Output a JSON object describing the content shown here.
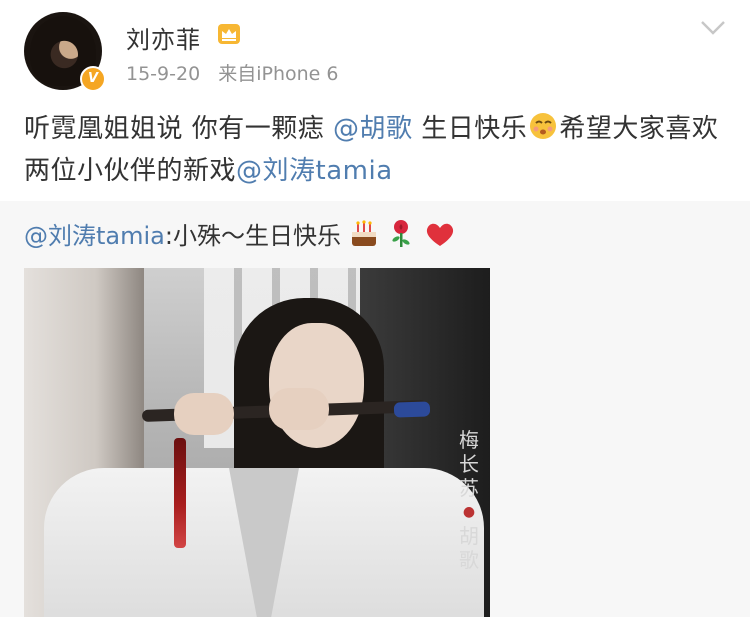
{
  "post": {
    "username": "刘亦菲",
    "verified_badge": "V",
    "timestamp": "15-9-20",
    "source": "来自iPhone 6",
    "text_part1": "听霓凰姐姐说 你有一颗痣 ",
    "mention1": "@胡歌",
    "text_part2": " 生日快乐",
    "text_part3": "希望大家喜欢两位小伙伴的新戏",
    "mention2": "@刘涛tamia"
  },
  "repost": {
    "mention": "@刘涛tamia",
    "text": ":小殊～生日快乐",
    "image": {
      "watermark_title": "梅长苏",
      "watermark_name": "胡歌"
    }
  },
  "icons": {
    "crown": "crown-icon",
    "chevron": "chevron-down-icon",
    "kiss_emoji": "kiss-emoji-icon",
    "cake_emoji": "cake-emoji-icon",
    "rose_emoji": "rose-emoji-icon",
    "heart_emoji": "heart-emoji-icon"
  },
  "colors": {
    "link": "#507daf",
    "meta": "#939393",
    "repost_bg": "#f7f7f7",
    "badge": "#f5a623"
  }
}
